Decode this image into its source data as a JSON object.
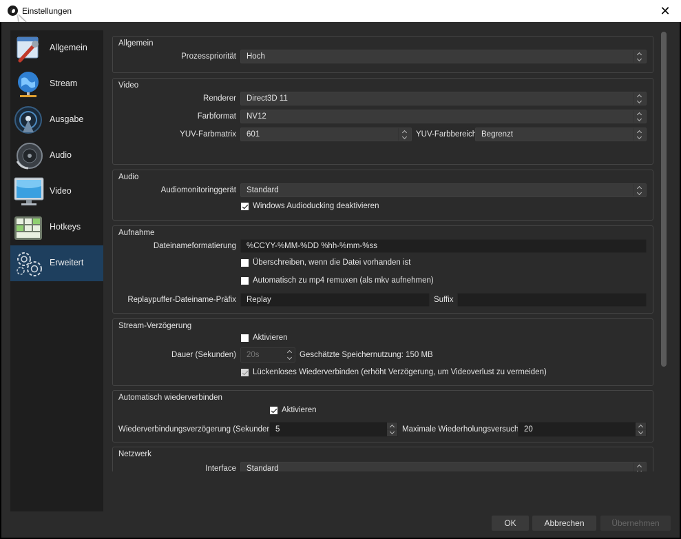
{
  "window": {
    "title": "Einstellungen",
    "close_label": "✕"
  },
  "sidebar": {
    "items": [
      {
        "label": "Allgemein",
        "icon": "general-settings-icon"
      },
      {
        "label": "Stream",
        "icon": "globe-icon"
      },
      {
        "label": "Ausgabe",
        "icon": "broadcast-antenna-icon"
      },
      {
        "label": "Audio",
        "icon": "speaker-icon"
      },
      {
        "label": "Video",
        "icon": "monitor-icon"
      },
      {
        "label": "Hotkeys",
        "icon": "keyboard-icon"
      },
      {
        "label": "Erweitert",
        "icon": "gears-icon",
        "active": true
      }
    ]
  },
  "groups": {
    "general": {
      "title": "Allgemein",
      "priority_label": "Prozesspriorität",
      "priority_value": "Hoch"
    },
    "video": {
      "title": "Video",
      "renderer_label": "Renderer",
      "renderer_value": "Direct3D 11",
      "format_label": "Farbformat",
      "format_value": "NV12",
      "matrix_label": "YUV-Farbmatrix",
      "matrix_value": "601",
      "range_label": "YUV-Farbbereich",
      "range_value": "Begrenzt"
    },
    "audio": {
      "title": "Audio",
      "monitor_label": "Audiomonitoringgerät",
      "monitor_value": "Standard",
      "ducking_label": "Windows Audioducking deaktivieren",
      "ducking_checked": true
    },
    "recording": {
      "title": "Aufnahme",
      "filename_label": "Dateinameformatierung",
      "filename_value": "%CCYY-%MM-%DD %hh-%mm-%ss",
      "overwrite_label": "Überschreiben, wenn die Datei vorhanden ist",
      "overwrite_checked": false,
      "remux_label": "Automatisch zu mp4 remuxen (als mkv aufnehmen)",
      "remux_checked": false,
      "replay_prefix_label": "Replaypuffer-Dateiname-Präfix",
      "replay_prefix_value": "Replay",
      "suffix_label": "Suffix",
      "suffix_value": ""
    },
    "stream_delay": {
      "title": "Stream-Verzögerung",
      "enable_label": "Aktivieren",
      "enable_checked": false,
      "duration_label": "Dauer (Sekunden)",
      "duration_value": "20s",
      "memory_label": "Geschätzte Speichernutzung: 150 MB",
      "preserve_label": "Lückenloses Wiederverbinden (erhöht Verzögerung, um Videoverlust zu vermeiden)",
      "preserve_checked": true
    },
    "reconnect": {
      "title": "Automatisch wiederverbinden",
      "enable_label": "Aktivieren",
      "enable_checked": true,
      "delay_label": "Wiederverbindungsverzögerung (Sekunden)",
      "delay_value": "5",
      "retries_label": "Maximale Wiederholungsversuche",
      "retries_value": "20"
    },
    "network": {
      "title": "Netzwerk",
      "interface_label": "Interface",
      "interface_value": "Standard"
    }
  },
  "footer": {
    "ok_label": "OK",
    "cancel_label": "Abbrechen",
    "apply_label": "Übernehmen"
  }
}
